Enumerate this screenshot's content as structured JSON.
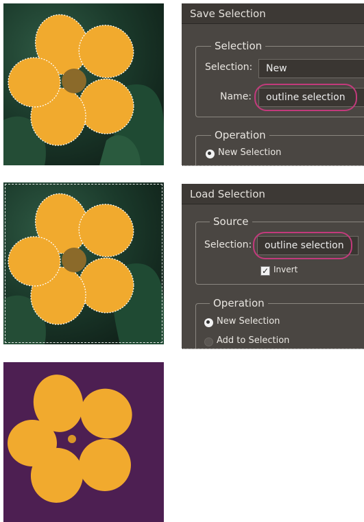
{
  "save_dialog": {
    "title": "Save Selection",
    "selection_group_label": "Selection",
    "selection_label": "Selection:",
    "selection_value": "New",
    "name_label": "Name:",
    "name_value": "outline selection",
    "operation_group_label": "Operation",
    "option_new_selection": "New Selection"
  },
  "load_dialog": {
    "title": "Load Selection",
    "source_group_label": "Source",
    "selection_label": "Selection:",
    "selection_value": "outline selection",
    "invert_label": "Invert",
    "operation_group_label": "Operation",
    "option_new_selection": "New Selection",
    "option_add_to_selection": "Add to Selection"
  },
  "colors": {
    "flower_petal": "#f1aa2e",
    "highlight_oval": "#c33a7c",
    "purple_background": "#4d1f52",
    "dialog_background": "#4a4642"
  }
}
